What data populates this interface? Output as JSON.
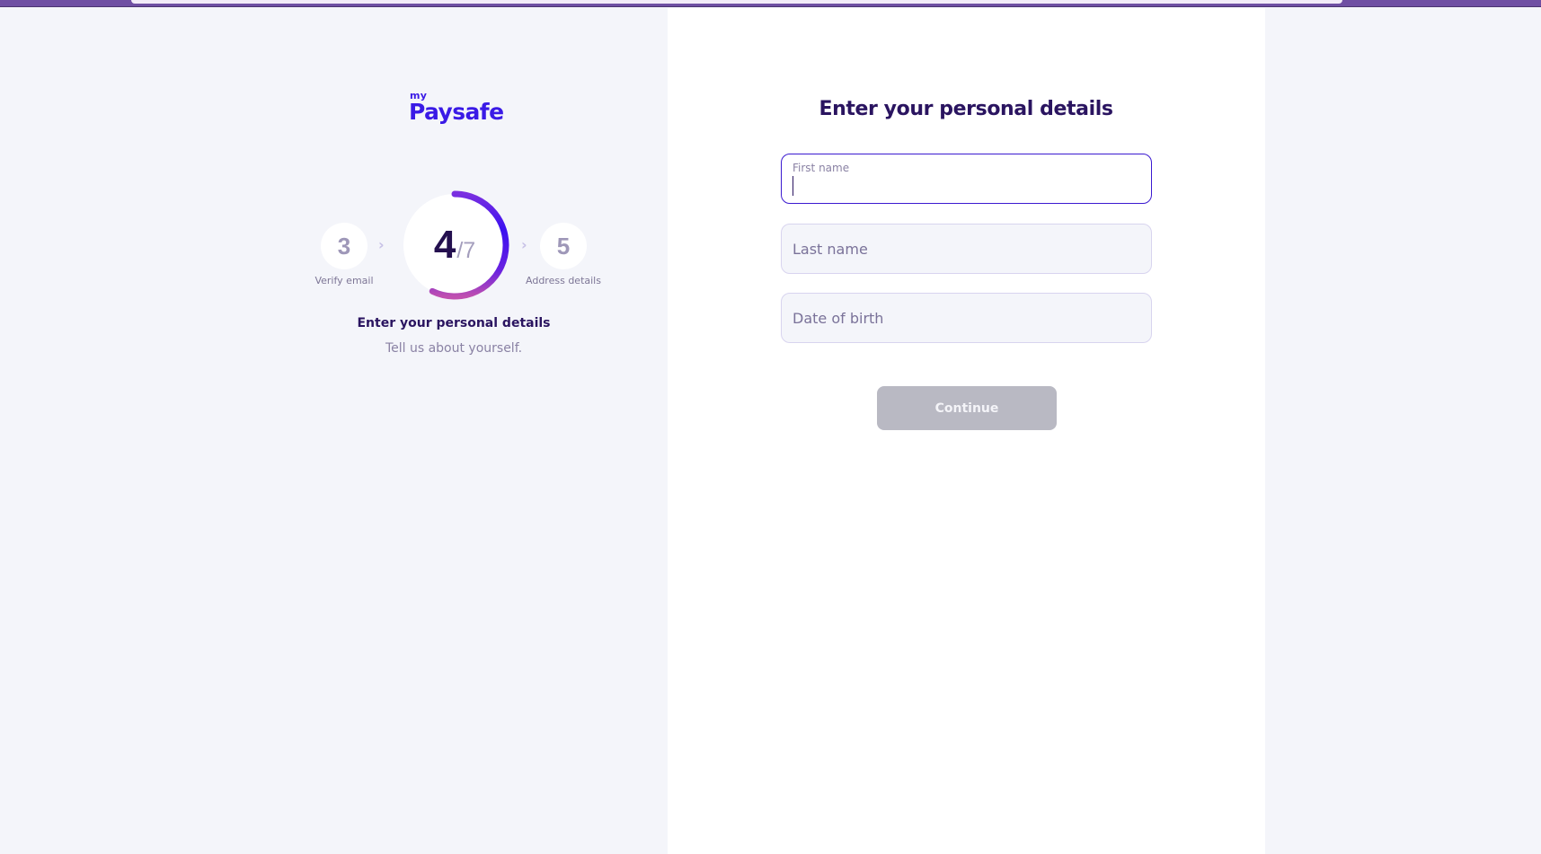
{
  "brand": {
    "logo_prefix": "my",
    "logo_name": "Paysafe",
    "accent_color": "#3a1ae6"
  },
  "stepper": {
    "previous": {
      "number": "3",
      "label": "Verify email"
    },
    "current": {
      "number": "4",
      "total_label": "/7",
      "step": 4,
      "total": 7
    },
    "next": {
      "number": "5",
      "label": "Address details"
    },
    "title": "Enter your personal details",
    "subtitle": "Tell us about yourself."
  },
  "form": {
    "title": "Enter your personal details",
    "fields": [
      {
        "label": "First name",
        "value": "",
        "state": "focused"
      },
      {
        "placeholder": "Last name",
        "value": ""
      },
      {
        "placeholder": "Date of birth",
        "value": ""
      }
    ],
    "continue_label": "Continue",
    "continue_disabled": true
  }
}
